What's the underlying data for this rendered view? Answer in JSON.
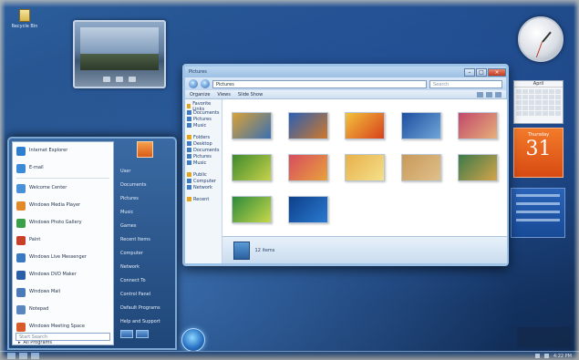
{
  "desktop": {
    "icon_label": "Recycle Bin"
  },
  "explorer": {
    "title": "Pictures",
    "address": "Pictures",
    "search_placeholder": "Search",
    "commands": [
      "Organize",
      "Views",
      "Slide Show"
    ],
    "nav_groups": [
      [
        "Favorite Links",
        "Documents",
        "Pictures",
        "Music"
      ],
      [
        "Folders",
        "Desktop",
        "Documents",
        "Pictures",
        "Music"
      ],
      [
        "Public",
        "Computer",
        "Network"
      ],
      [
        "Recent"
      ]
    ],
    "thumbnails": [
      {
        "color1": "#d9a238",
        "color2": "#3a6fb0"
      },
      {
        "color1": "#2a5fb4",
        "color2": "#d0782a"
      },
      {
        "color1": "#f2c33c",
        "color2": "#d8401c"
      },
      {
        "color1": "#1d4fa0",
        "color2": "#6fa6d8"
      },
      {
        "color1": "#c2486a",
        "color2": "#e6b07a"
      },
      {
        "color1": "#3e8a2c",
        "color2": "#c8d24a"
      },
      {
        "color1": "#d84c5e",
        "color2": "#e8a23c"
      },
      {
        "color1": "#e8b04a",
        "color2": "#f4e08a"
      },
      {
        "color1": "#c89a5a",
        "color2": "#e0c08a"
      },
      {
        "color1": "#3d7a4a",
        "color2": "#d4a44a"
      },
      {
        "color1": "#2d8a3a",
        "color2": "#c8d84a"
      },
      {
        "color1": "#0e3f8a",
        "color2": "#2a7ad0"
      }
    ],
    "details_text": "12 items"
  },
  "start_menu": {
    "pinned": [
      {
        "label": "Internet Explorer",
        "color": "#2f7fd0"
      },
      {
        "label": "E-mail",
        "color": "#3a8ad8"
      }
    ],
    "recent": [
      {
        "label": "Welcome Center",
        "color": "#4a90d8"
      },
      {
        "label": "Windows Media Player",
        "color": "#e28a2a"
      },
      {
        "label": "Windows Photo Gallery",
        "color": "#3aa04a"
      },
      {
        "label": "Paint",
        "color": "#c8402a"
      },
      {
        "label": "Windows Live Messenger",
        "color": "#3a78c0"
      },
      {
        "label": "Windows DVD Maker",
        "color": "#2a5fa8"
      },
      {
        "label": "Windows Mail",
        "color": "#4a7ab8"
      },
      {
        "label": "Notepad",
        "color": "#5a86c0"
      },
      {
        "label": "Windows Meeting Space",
        "color": "#d85a2a"
      }
    ],
    "all_programs": "All Programs",
    "search_placeholder": "Start Search",
    "right_links": [
      "User",
      "Documents",
      "Pictures",
      "Music",
      "Games",
      "Recent Items",
      "Computer",
      "Network",
      "Connect To",
      "Control Panel",
      "Default Programs",
      "Help and Support"
    ]
  },
  "calendar": {
    "month": "April",
    "weekday": "Thursday",
    "day": "31"
  },
  "tray": {
    "time": "4:22 PM"
  }
}
